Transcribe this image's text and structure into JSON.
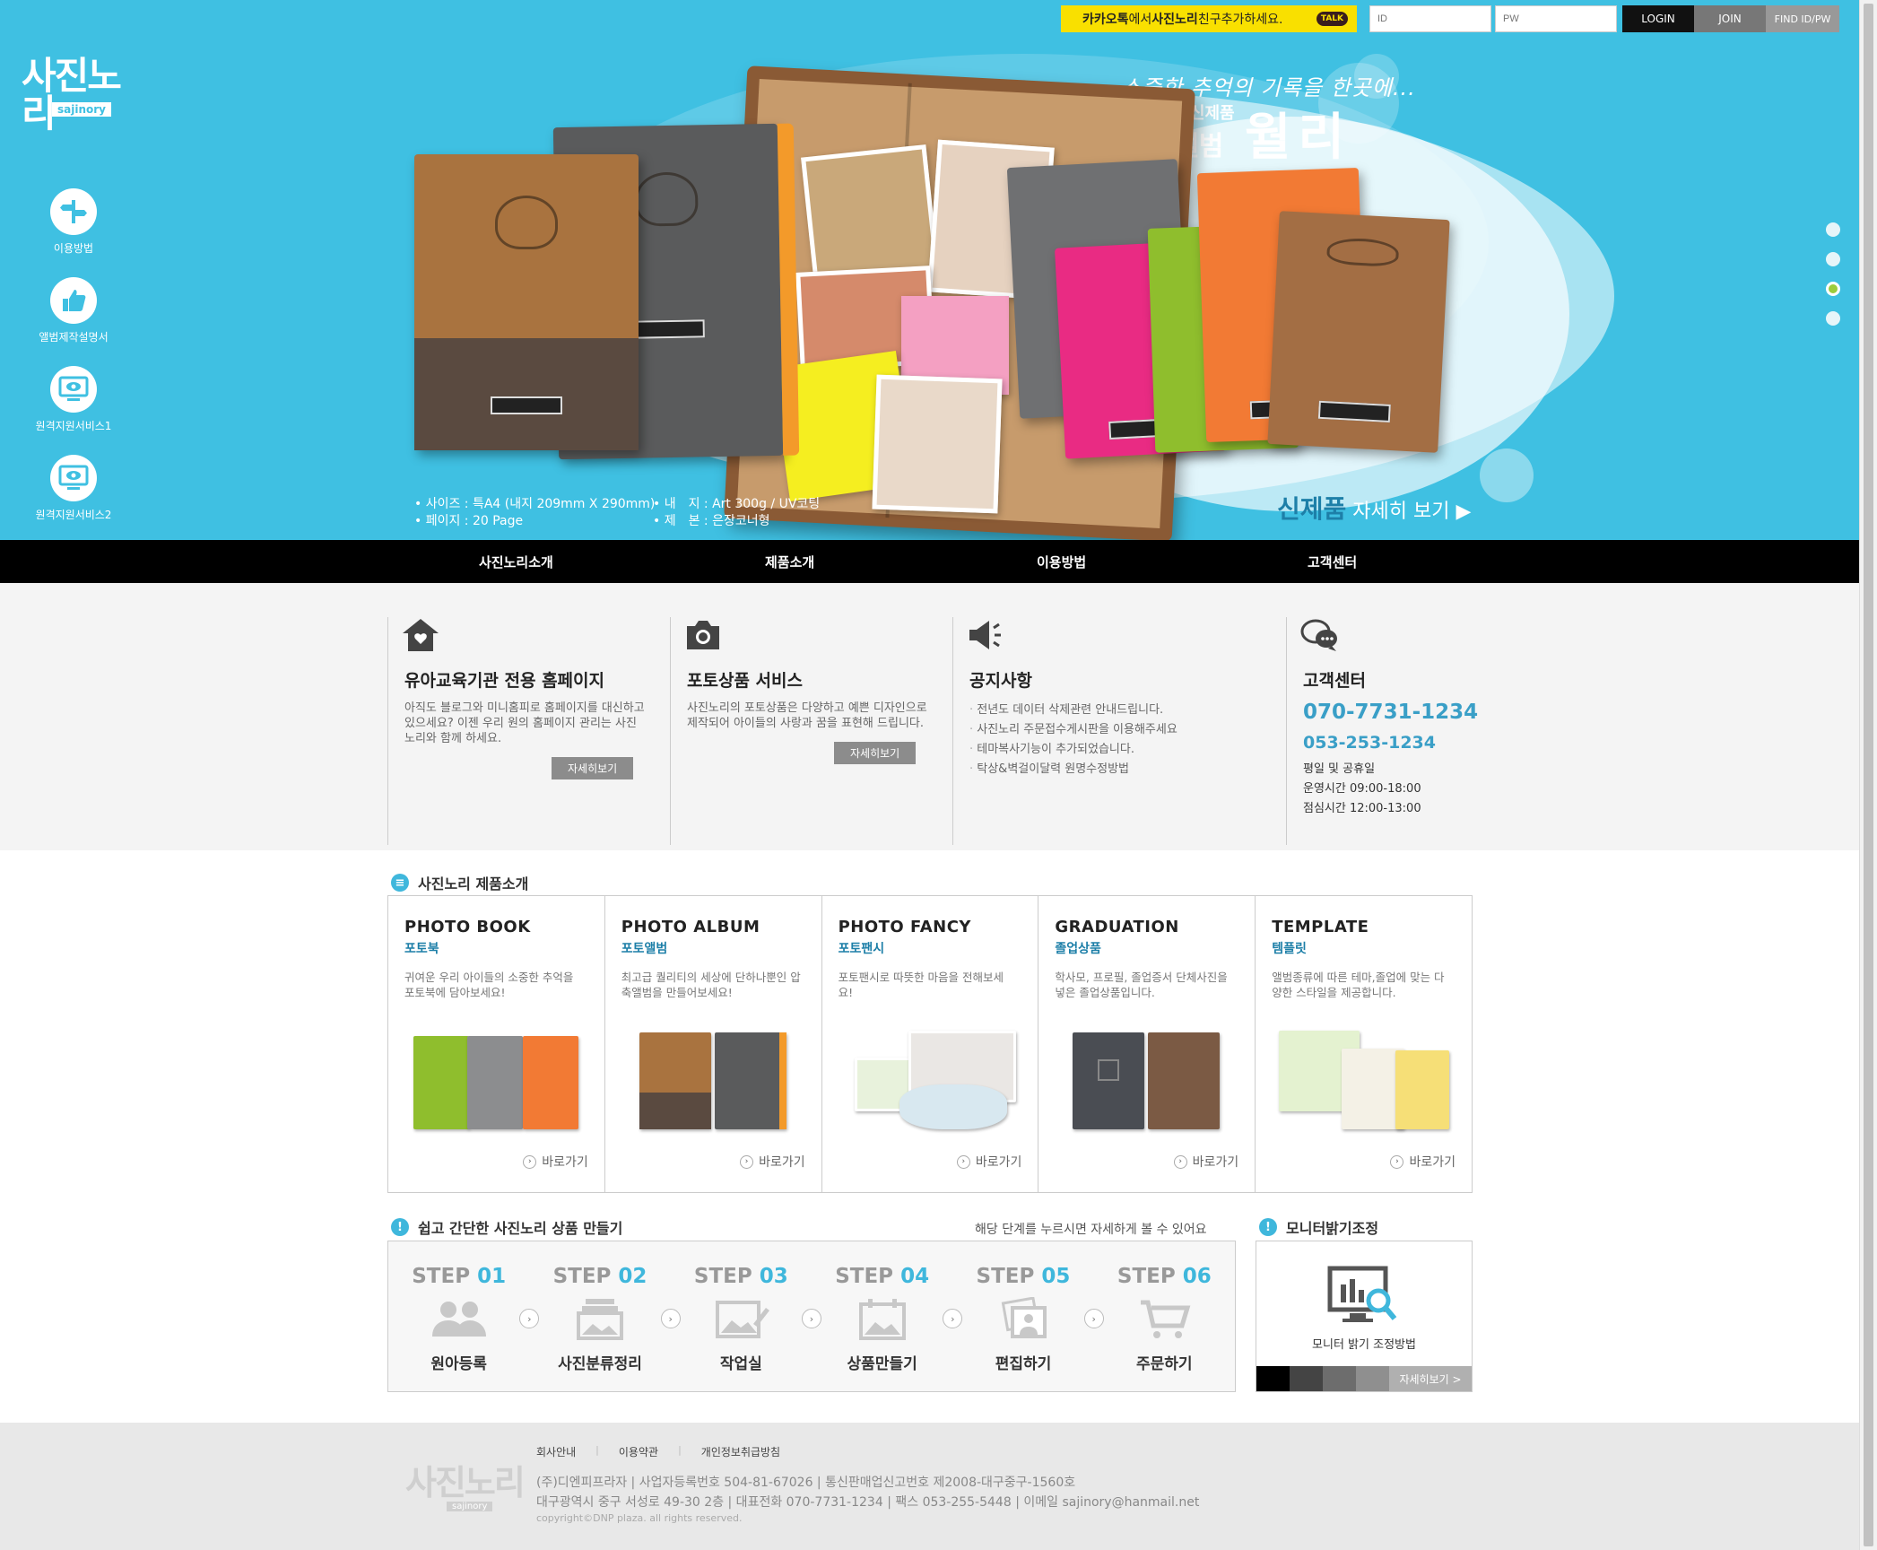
{
  "logo": {
    "text": "사진노리",
    "en": "sajinory"
  },
  "side_menu": [
    {
      "label": "이용방법",
      "icon": "signpost-icon"
    },
    {
      "label": "앨범제작설명서",
      "icon": "thumbs-up-icon"
    },
    {
      "label": "원격지원서비스1",
      "icon": "monitor-eye-icon"
    },
    {
      "label": "원격지원서비스2",
      "icon": "monitor-eye-icon"
    }
  ],
  "topbar": {
    "kakao_pre": "카카오톡",
    "kakao_mid": "에서 ",
    "kakao_bold": "사진노리",
    "kakao_post": " 친구추가하세요.",
    "kakao_badge": "TALK",
    "id_placeholder": "ID",
    "pw_placeholder": "PW",
    "login": "LOGIN",
    "join": "JOIN",
    "find": "FIND ID/PW"
  },
  "hero": {
    "tagline": "소중한 추억의 기록을 한곳에...",
    "sub": "2020년 신제품",
    "title": "은장앨범",
    "title_big": "월리",
    "spec_left": [
      "• 사이즈 : 특A4 (내지 209mm X 290mm)",
      "• 페이지 : 20 Page"
    ],
    "spec_right": [
      "• 내　지 : Art 300g / UV코팅",
      "• 제　본 : 은장코너형"
    ],
    "new_bold": "신제품",
    "new_rest": " 자세히 보기 ▶",
    "slide_count": 4,
    "active_slide": 3
  },
  "gnb": [
    "사진노리소개",
    "제품소개",
    "이용방법",
    "고객센터"
  ],
  "info": {
    "col1": {
      "title": "유아교육기관 전용 홈페이지",
      "desc": "아직도 블로그와 미니홈피로 홈페이지를 대신하고 있으세요? 이젠 우리 원의 홈페이지 관리는 사진노리와 함께 하세요.",
      "btn": "자세히보기"
    },
    "col2": {
      "title": "포토상품 서비스",
      "desc": "사진노리의 포토상품은 다양하고 예쁜 디자인으로 제작되어 아이들의 사랑과 꿈을 표현해 드립니다.",
      "btn": "자세히보기"
    },
    "col3": {
      "title": "공지사항",
      "items": [
        "전년도 데이터 삭제관련 안내드립니다.",
        "사진노리 주문접수게시판을 이용해주세요",
        "테마복사기능이 추가되었습니다.",
        "탁상&벽걸이달력 원명수정방법"
      ]
    },
    "col4": {
      "title": "고객센터",
      "phone1": "070-7731-1234",
      "phone2": "053-253-1234",
      "hours": [
        "평일 및 공휴일",
        "운영시간 09:00-18:00",
        "점심시간 12:00-13:00"
      ]
    }
  },
  "products_title": "사진노리 제품소개",
  "products": [
    {
      "en": "PHOTO BOOK",
      "ko": "포토북",
      "desc": "귀여운 우리 아이들의 소중한 추억을 포토북에 담아보세요!",
      "go": "바로가기"
    },
    {
      "en": "PHOTO ALBUM",
      "ko": "포토앨범",
      "desc": "최고급 퀄리티의 세상에 단하나뿐인 압축앨범을 만들어보세요!",
      "go": "바로가기"
    },
    {
      "en": "PHOTO FANCY",
      "ko": "포토팬시",
      "desc": "포토팬시로 따뜻한 마음을 전해보세요!",
      "go": "바로가기"
    },
    {
      "en": "GRADUATION",
      "ko": "졸업상품",
      "desc": "학사모, 프로필, 졸업증서 단체사진을 넣은 졸업상품입니다.",
      "go": "바로가기"
    },
    {
      "en": "TEMPLATE",
      "ko": "템플릿",
      "desc": "앨범종류에 따른 테마,졸업에 맞는 다양한 스타일을 제공합니다.",
      "go": "바로가기"
    }
  ],
  "steps_title": "쉽고 간단한 사진노리 상품 만들기",
  "steps_note": "해당 단계를 누르시면 자세하게 볼 수 있어요",
  "steps": [
    {
      "prefix": "STEP ",
      "num": "01",
      "label": "원아등록"
    },
    {
      "prefix": "STEP ",
      "num": "02",
      "label": "사진분류정리"
    },
    {
      "prefix": "STEP ",
      "num": "03",
      "label": "작업실"
    },
    {
      "prefix": "STEP ",
      "num": "04",
      "label": "상품만들기"
    },
    {
      "prefix": "STEP ",
      "num": "05",
      "label": "편집하기"
    },
    {
      "prefix": "STEP ",
      "num": "06",
      "label": "주문하기"
    }
  ],
  "monitor": {
    "title": "모니터밝기조정",
    "label": "모니터 밝기 조정방법",
    "more": "자세히보기 >",
    "swatches": [
      "#000000",
      "#444444",
      "#6d6d6d",
      "#8f8f8f"
    ]
  },
  "footer": {
    "logo": "사진노리",
    "logo_en": "sajinory",
    "links": [
      "회사안내",
      "이용약관",
      "개인정보취급방침"
    ],
    "line1": "(주)디엔피프라자 | 사업자등록번호 504-81-67026 | 통신판매업신고번호 제2008-대구중구-1560호",
    "line2": "대구광역시 중구 서성로 49-30 2층 | 대표전화 070-7731-1234 | 팩스 053-255-5448 | 이메일 sajinory@hanmail.net",
    "copy": "copyright©DNP plaza. all rights reserved."
  },
  "colors": {
    "sky": "#3fc0e2",
    "accent": "#3a9fc7",
    "kakao": "#f9e000",
    "dark": "#000000"
  }
}
